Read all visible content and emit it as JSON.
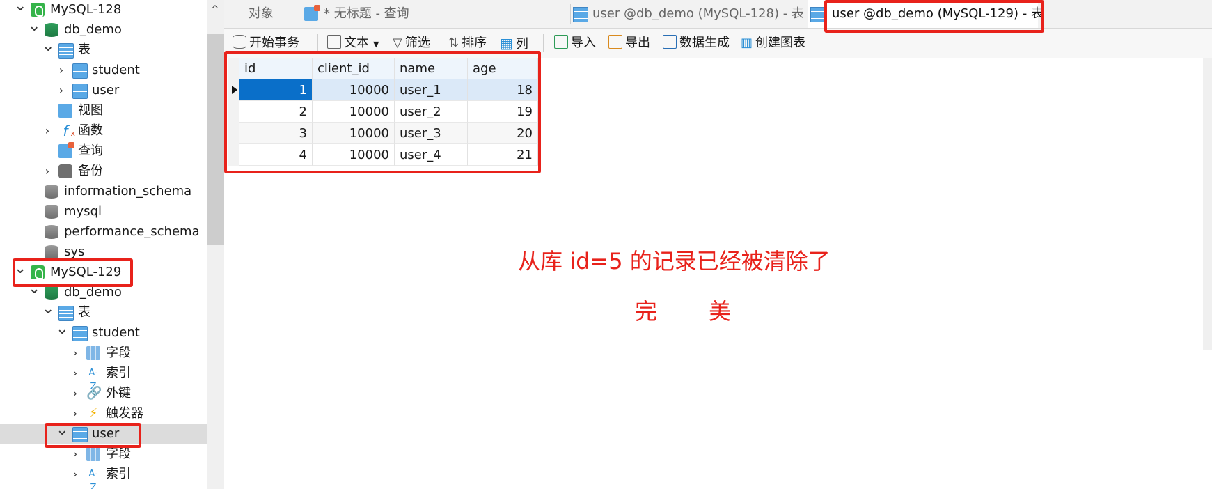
{
  "sidebar": {
    "tree": [
      {
        "label": "MySQL-128",
        "icon": "mysql-connection-icon",
        "chevron": "expanded"
      },
      {
        "label": "db_demo",
        "icon": "database-icon",
        "chevron": "expanded"
      },
      {
        "label": "表",
        "icon": "tables-folder-icon",
        "chevron": "expanded"
      },
      {
        "label": "student",
        "icon": "table-icon",
        "chevron": "collapsed"
      },
      {
        "label": "user",
        "icon": "table-icon",
        "chevron": "collapsed"
      },
      {
        "label": "视图",
        "icon": "views-icon",
        "chevron": "none"
      },
      {
        "label": "函数",
        "icon": "function-icon",
        "chevron": "collapsed"
      },
      {
        "label": "查询",
        "icon": "query-icon",
        "chevron": "none"
      },
      {
        "label": "备份",
        "icon": "backup-icon",
        "chevron": "collapsed"
      },
      {
        "label": "information_schema",
        "icon": "database-gray-icon",
        "chevron": "none"
      },
      {
        "label": "mysql",
        "icon": "database-gray-icon",
        "chevron": "none"
      },
      {
        "label": "performance_schema",
        "icon": "database-gray-icon",
        "chevron": "none"
      },
      {
        "label": "sys",
        "icon": "database-gray-icon",
        "chevron": "none"
      },
      {
        "label": "MySQL-129",
        "icon": "mysql-connection-icon",
        "chevron": "expanded"
      },
      {
        "label": "db_demo",
        "icon": "database-icon",
        "chevron": "expanded"
      },
      {
        "label": "表",
        "icon": "tables-folder-icon",
        "chevron": "expanded"
      },
      {
        "label": "student",
        "icon": "table-icon",
        "chevron": "expanded"
      },
      {
        "label": "字段",
        "icon": "fields-icon",
        "chevron": "collapsed"
      },
      {
        "label": "索引",
        "icon": "index-icon",
        "icon_text": "A-Z",
        "chevron": "collapsed"
      },
      {
        "label": "外键",
        "icon": "foreign-key-icon",
        "icon_text": "🔗",
        "chevron": "collapsed"
      },
      {
        "label": "触发器",
        "icon": "trigger-icon",
        "icon_text": "⚡",
        "chevron": "collapsed"
      },
      {
        "label": "user",
        "icon": "table-icon",
        "chevron": "expanded",
        "selected": true
      },
      {
        "label": "字段",
        "icon": "fields-icon",
        "chevron": "collapsed"
      },
      {
        "label": "索引",
        "icon": "index-icon",
        "icon_text": "A-Z",
        "chevron": "collapsed"
      }
    ]
  },
  "tabs": [
    {
      "label": "对象",
      "icon": ""
    },
    {
      "label": "* 无标题 - 查询",
      "icon": "query-icon"
    },
    {
      "label": "user @db_demo (MySQL-128) - 表",
      "icon": "table-icon"
    },
    {
      "label": "user @db_demo (MySQL-129) - 表",
      "icon": "table-icon",
      "active": true
    }
  ],
  "toolbar": {
    "begin_transaction": "开始事务",
    "text": "文本",
    "filter": "筛选",
    "sort": "排序",
    "columns": "列",
    "import": "导入",
    "export": "导出",
    "data_generation": "数据生成",
    "create_chart": "创建图表"
  },
  "grid": {
    "columns": [
      "id",
      "client_id",
      "name",
      "age"
    ],
    "rows": [
      [
        "1",
        "10000",
        "user_1",
        "18"
      ],
      [
        "2",
        "10000",
        "user_2",
        "19"
      ],
      [
        "3",
        "10000",
        "user_3",
        "20"
      ],
      [
        "4",
        "10000",
        "user_4",
        "21"
      ]
    ]
  },
  "annotations": {
    "note": "从库 id=5 的记录已经被清除了",
    "perfect_1": "完",
    "perfect_2": "美"
  },
  "colors": {
    "highlight": "#e8221b",
    "selection": "#0a6fc9"
  }
}
